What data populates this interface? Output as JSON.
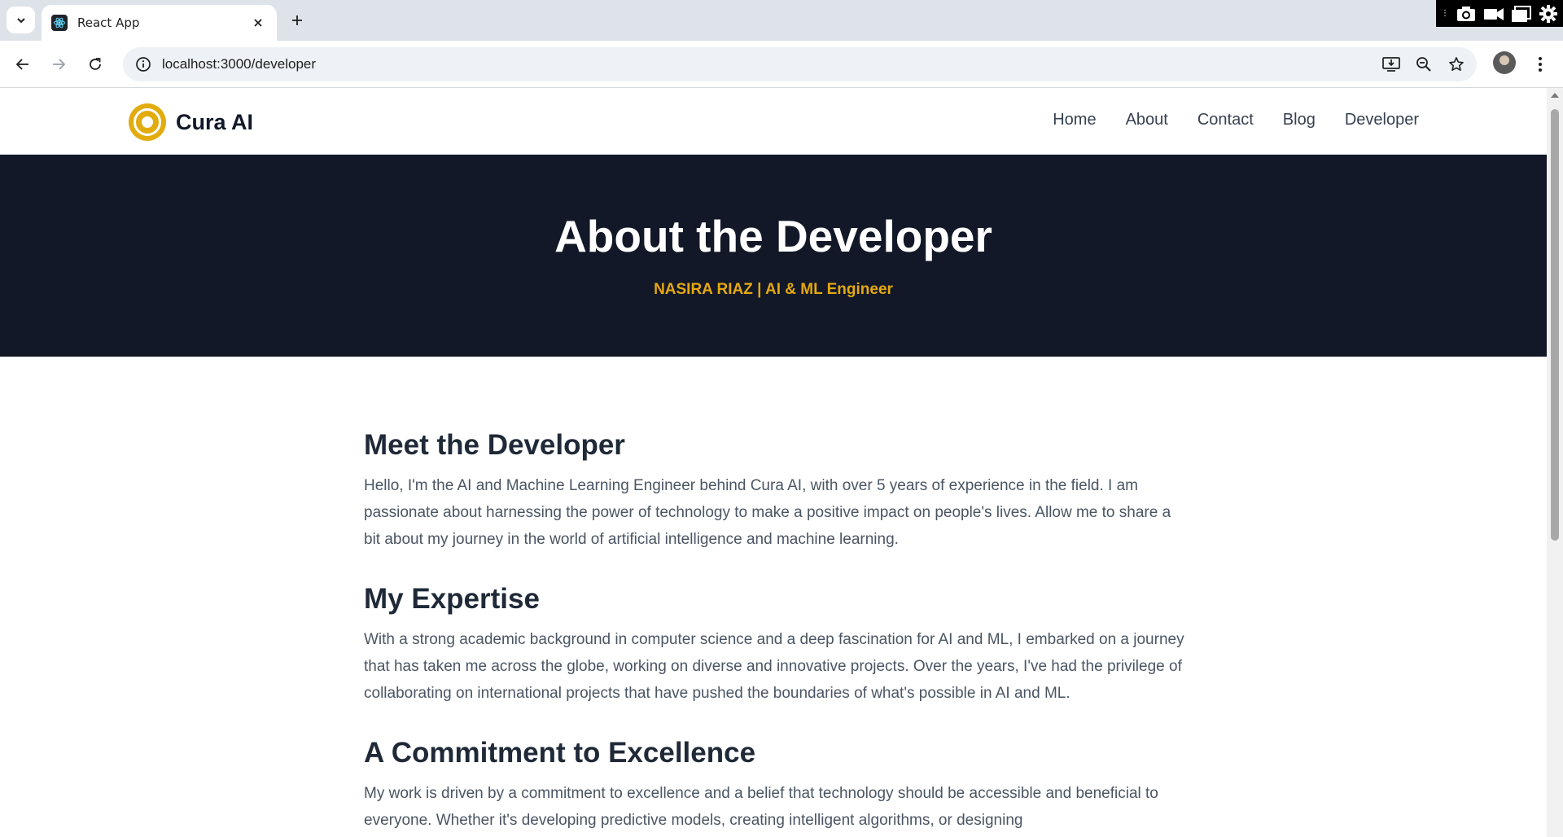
{
  "browser": {
    "tab_title": "React App",
    "url": "localhost:3000/developer"
  },
  "site": {
    "brand": "Cura AI",
    "nav": [
      "Home",
      "About",
      "Contact",
      "Blog",
      "Developer"
    ]
  },
  "hero": {
    "title": "About the Developer",
    "subtitle": "NASIRA RIAZ | AI & ML Engineer"
  },
  "sections": [
    {
      "heading": "Meet the Developer",
      "body": "Hello, I'm the AI and Machine Learning Engineer behind Cura AI, with over 5 years of experience in the field. I am passionate about harnessing the power of technology to make a positive impact on people's lives. Allow me to share a bit about my journey in the world of artificial intelligence and machine learning."
    },
    {
      "heading": "My Expertise",
      "body": "With a strong academic background in computer science and a deep fascination for AI and ML, I embarked on a journey that has taken me across the globe, working on diverse and innovative projects. Over the years, I've had the privilege of collaborating on international projects that have pushed the boundaries of what's possible in AI and ML."
    },
    {
      "heading": "A Commitment to Excellence",
      "body": "My work is driven by a commitment to excellence and a belief that technology should be accessible and beneficial to everyone. Whether it's developing predictive models, creating intelligent algorithms, or designing"
    }
  ]
}
